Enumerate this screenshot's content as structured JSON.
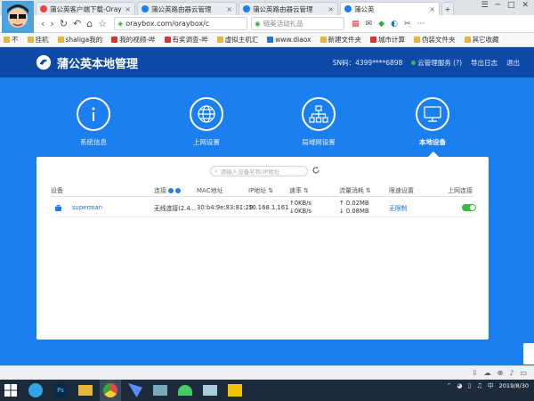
{
  "browser": {
    "tabs": [
      {
        "title": "蒲公英客户端下载-Oray贝锐",
        "active": false
      },
      {
        "title": "蒲公英路由器云管理",
        "active": false
      },
      {
        "title": "蒲公英路由器云管理",
        "active": false
      },
      {
        "title": "蒲公英",
        "active": true
      }
    ],
    "url": "oraybox.com/oraybox/c",
    "search_placeholder": "链美活动礼品",
    "bookmarks": [
      "不",
      "挂机",
      "shaliga我的",
      "我的视频-哔",
      "有奖调查-哔",
      "虚拟主机汇",
      "www.diaox",
      "新建文件夹",
      "城市计算",
      "伪装文件夹",
      "其它收藏"
    ]
  },
  "app": {
    "title": "蒲公英本地管理",
    "sn_label": "SN码：4399****6898",
    "cloud_service": "云管理服务 (?)",
    "export_log": "导出日志",
    "logout": "退出"
  },
  "nav": [
    {
      "label": "系统信息",
      "icon": "info-icon"
    },
    {
      "label": "上网设置",
      "icon": "globe-icon"
    },
    {
      "label": "局域网设置",
      "icon": "network-icon"
    },
    {
      "label": "本地设备",
      "icon": "monitor-icon"
    }
  ],
  "filter_placeholder": "请输入设备名称/IP地址",
  "table": {
    "headers": [
      "设备",
      "连接",
      "MAC地址",
      "IP地址",
      "速率",
      "流量消耗",
      "限速设置",
      "上网连接"
    ],
    "rows": [
      {
        "device": "superman",
        "connection": "无线连接(2.4...",
        "mac": "30:b4:9e:83:81:29",
        "ip": "10.168.1.161",
        "speed_up": "↑0KB/s",
        "speed_down": "↓0KB/s",
        "traffic_up": "↑ 0.02MB",
        "traffic_down": "↓ 0.08MB",
        "limit": "无限制",
        "online": true
      }
    ]
  },
  "clock": {
    "time": "2019/8/30"
  },
  "colors": {
    "header": "#0d4aa8",
    "body": "#1c7ff0",
    "link": "#1c6fdc",
    "toggle_on": "#3cba3c"
  }
}
